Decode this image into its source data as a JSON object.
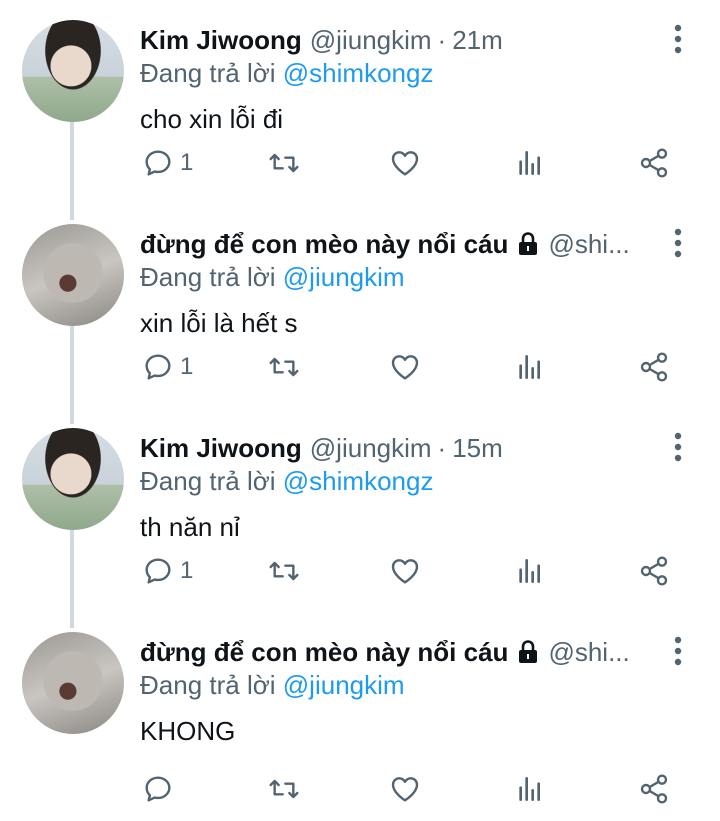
{
  "tweets": [
    {
      "name": "Kim Jiwoong",
      "handle": "@jiungkim",
      "dot": "·",
      "time": "21m",
      "reply_prefix": "Đang trả lời ",
      "reply_to": "@shimkongz",
      "text": "cho xin lỗi đi",
      "reply_count": "1",
      "locked": false,
      "avatar": "kim"
    },
    {
      "name": "đừng để con mèo này nổi cáu",
      "handle": "@shi...",
      "reply_prefix": "Đang trả lời ",
      "reply_to": "@jiungkim",
      "text": "xin lỗi là hết s",
      "reply_count": "1",
      "locked": true,
      "avatar": "cat"
    },
    {
      "name": "Kim Jiwoong",
      "handle": "@jiungkim",
      "dot": "·",
      "time": "15m",
      "reply_prefix": "Đang trả lời ",
      "reply_to": "@shimkongz",
      "text": "th năn nỉ",
      "reply_count": "1",
      "locked": false,
      "avatar": "kim"
    },
    {
      "name": "đừng để con mèo này nổi cáu",
      "handle": "@shi...",
      "reply_prefix": "Đang trả lời ",
      "reply_to": "@jiungkim",
      "text": "KHONG",
      "reply_count": "",
      "locked": true,
      "avatar": "cat"
    }
  ],
  "icons": {
    "reply": "reply-icon",
    "retweet": "retweet-icon",
    "like": "heart-icon",
    "analytics": "analytics-icon",
    "share": "share-icon",
    "more": "more-vertical-icon",
    "lock": "lock-icon"
  },
  "colors": {
    "link": "#1d9bf0",
    "secondary_text": "#536471",
    "primary_text": "#0f1419",
    "thread_line": "#cfd9de"
  }
}
